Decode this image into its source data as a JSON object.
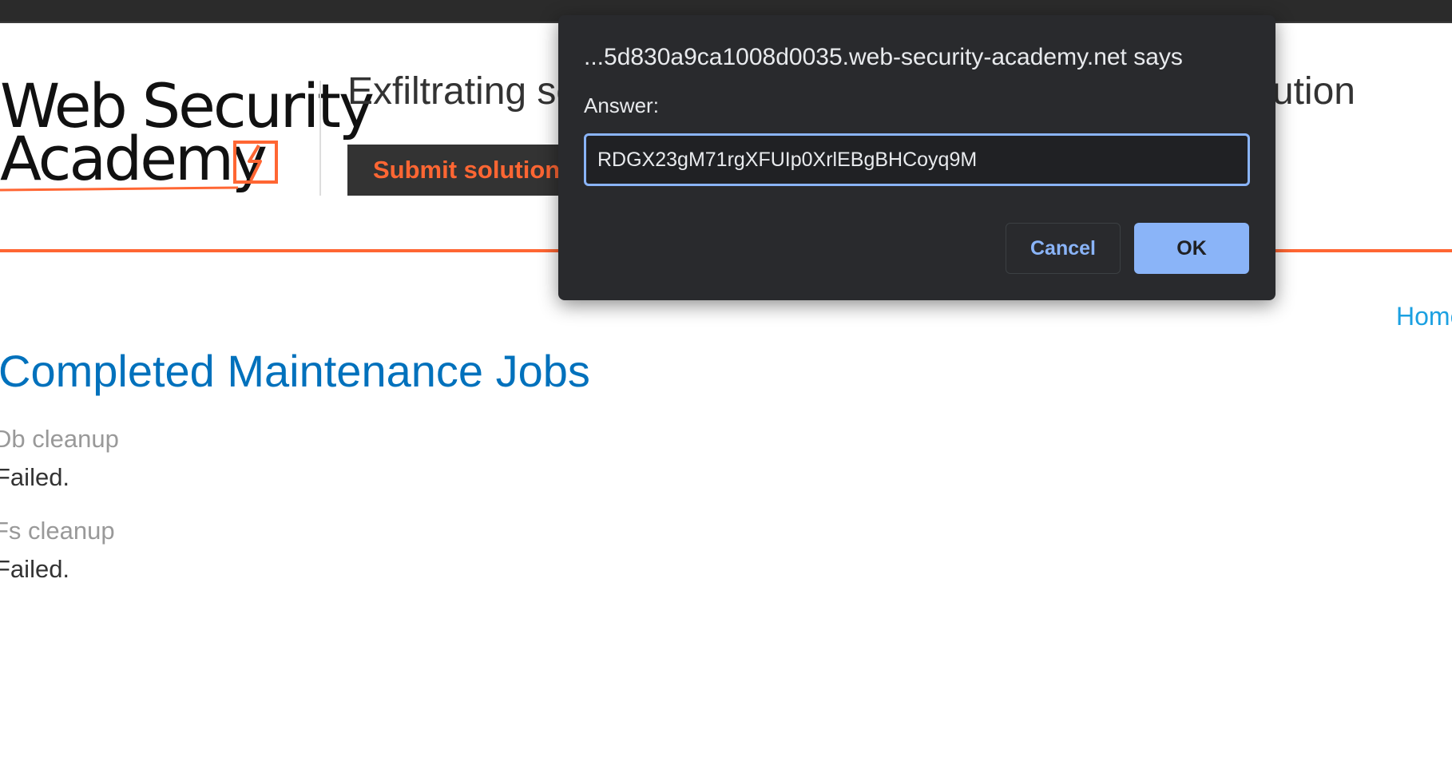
{
  "header": {
    "logo_line1": "Web Security",
    "logo_line2": "Academy",
    "lab_title": "Exfiltrating sensitive data via server-side prototype pollution",
    "submit_label": "Submit solution"
  },
  "nav": {
    "home_label": "Home"
  },
  "main": {
    "title": "Completed Maintenance Jobs",
    "jobs": [
      {
        "name": "Db cleanup",
        "status": "Failed."
      },
      {
        "name": "Fs cleanup",
        "status": "Failed."
      }
    ]
  },
  "dialog": {
    "title": "...5d830a9ca1008d0035.web-security-academy.net says",
    "label": "Answer:",
    "input_value": "RDGX23gM71rgXFUIp0XrlEBgBHCoyq9M",
    "cancel_label": "Cancel",
    "ok_label": "OK"
  },
  "colors": {
    "accent": "#ff6633",
    "link": "#0071bc",
    "dialog_bg": "#292a2d",
    "dialog_accent": "#8ab4f8"
  }
}
